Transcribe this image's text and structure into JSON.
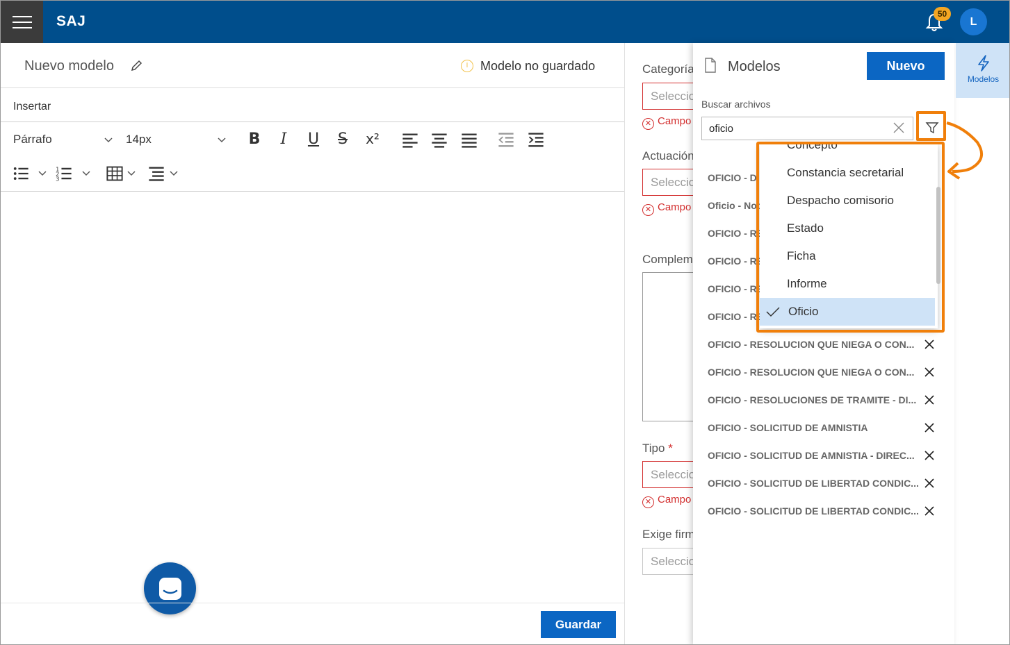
{
  "app": {
    "brand": "SAJ",
    "notifications_count": "50",
    "user_initial": "L"
  },
  "editor": {
    "title": "Nuevo modelo",
    "status": "Modelo no guardado",
    "menu_insert": "Insertar",
    "paragraph_style": "Párrafo",
    "font_size": "14px",
    "save_label": "Guardar"
  },
  "form": {
    "placeholder": "Seleccione",
    "error_text": "Campo obligatorio",
    "fields": [
      {
        "label": "Categoría",
        "required": false
      },
      {
        "label": "Actuación",
        "required": false
      },
      {
        "label": "Complemento",
        "required": false
      },
      {
        "label": "Tipo",
        "required": true
      },
      {
        "label": "Exige firma",
        "required": false
      }
    ]
  },
  "panel": {
    "title": "Modelos",
    "new_button": "Nuevo",
    "search_label": "Buscar archivos",
    "search_value": "oficio",
    "results": [
      "OFICIO - DIRECCION DE ...",
      "Oficio - Notificacion ...",
      "OFICIO - RESOLUCION ...",
      "OFICIO - RESOLUCION ...",
      "OFICIO - RESOLUCION ...",
      "OFICIO - RESOLUCION ...",
      "OFICIO - RESOLUCION QUE NIEGA O CON...",
      "OFICIO - RESOLUCION QUE NIEGA O CON...",
      "OFICIO - RESOLUCIONES DE TRAMITE - DI...",
      "OFICIO - SOLICITUD DE AMNISTIA",
      "OFICIO - SOLICITUD DE AMNISTIA - DIREC...",
      "OFICIO - SOLICITUD DE LIBERTAD CONDIC...",
      "OFICIO - SOLICITUD DE LIBERTAD CONDIC..."
    ]
  },
  "type_filter": {
    "options": [
      "Concepto",
      "Constancia secretarial",
      "Despacho comisorio",
      "Estado",
      "Ficha",
      "Informe",
      "Oficio"
    ],
    "selected": "Oficio"
  },
  "sidetab": {
    "label": "Modelos"
  },
  "colors": {
    "header": "#004e8c",
    "primary": "#0b66c3",
    "highlight": "#f07f0a",
    "error": "#d32f2f"
  }
}
